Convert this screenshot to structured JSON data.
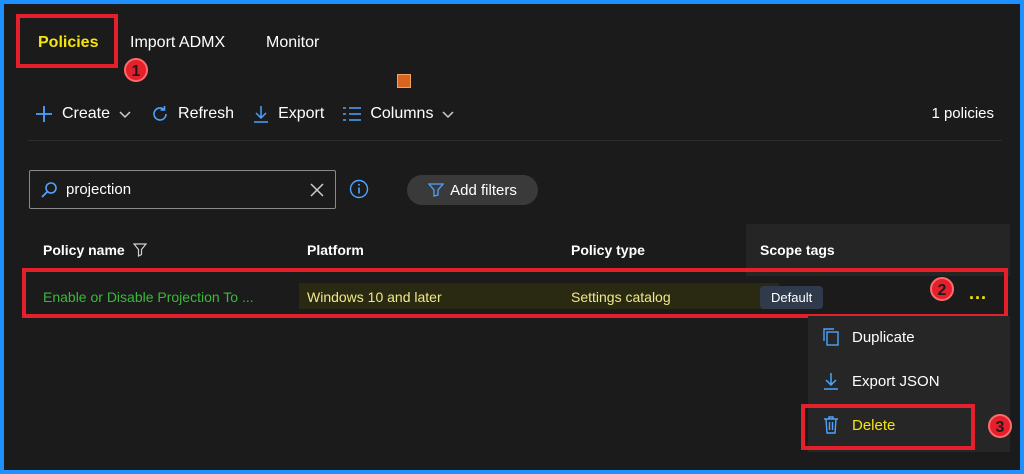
{
  "tabs": [
    {
      "label": "Policies",
      "active": true
    },
    {
      "label": "Import ADMX",
      "active": false
    },
    {
      "label": "Monitor",
      "active": false
    }
  ],
  "toolbar": {
    "create_label": "Create",
    "refresh_label": "Refresh",
    "export_label": "Export",
    "columns_label": "Columns",
    "count_text": "1 policies"
  },
  "search": {
    "value": "projection"
  },
  "filters": {
    "label": "Add filters"
  },
  "table": {
    "columns": [
      "Policy name",
      "Platform",
      "Policy type",
      "Scope tags"
    ],
    "rows": [
      {
        "name": "Enable or Disable Projection To ...",
        "platform": "Windows 10 and later",
        "type": "Settings catalog",
        "scope_tag": "Default",
        "more": "..."
      }
    ]
  },
  "context_menu": {
    "items": [
      {
        "label": "Duplicate",
        "icon": "copy-icon"
      },
      {
        "label": "Export JSON",
        "icon": "download-icon"
      },
      {
        "label": "Delete",
        "icon": "trash-icon"
      }
    ]
  },
  "annotations": {
    "step1": "1",
    "step2": "2",
    "step3": "3"
  },
  "colors": {
    "accent": "#1e90ff",
    "highlight_box": "#e3202b",
    "highlight_text": "#f5e50c",
    "link_green": "#3bb83b",
    "background": "#1b1b1b"
  }
}
